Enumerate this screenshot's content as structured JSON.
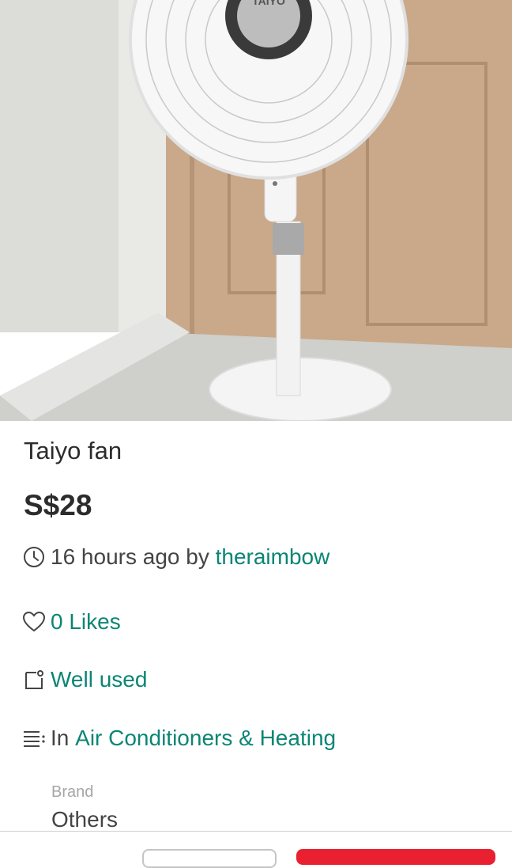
{
  "listing": {
    "photo_alt": "product-photo",
    "title": "Taiyo fan",
    "price": "S$28",
    "posted_time": "16 hours ago by",
    "seller": "theraimbow",
    "likes": "0 Likes",
    "condition": "Well used",
    "category_prefix": "In",
    "category": "Air Conditioners & Heating",
    "brand_label": "Brand",
    "brand_value": "Others",
    "fan_logo": "TAIYO"
  },
  "icons": {
    "time": "clock-icon",
    "likes": "heart-icon",
    "condition": "tag-icon",
    "category": "list-icon"
  },
  "colors": {
    "accent": "#0b8574",
    "primary_button": "#e8202f"
  }
}
